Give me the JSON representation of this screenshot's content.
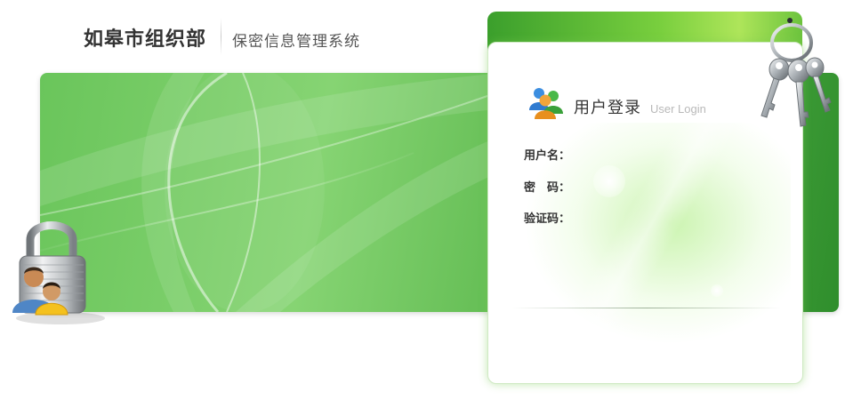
{
  "header": {
    "org_name": "如皋市组织部",
    "system_name": "保密信息管理系统"
  },
  "login": {
    "title": "用户登录",
    "subtitle": "User Login",
    "fields": [
      {
        "label": "用户名：",
        "value": ""
      },
      {
        "label": "密　码：",
        "value": ""
      },
      {
        "label": "验证码：",
        "value": ""
      }
    ]
  },
  "colors": {
    "banner_green": "#5cb84d",
    "banner_dark": "#2f8e2c",
    "accent_green": "#79cf3e"
  },
  "icons": [
    "padlock-users-icon",
    "users-icon",
    "keys-icon"
  ]
}
